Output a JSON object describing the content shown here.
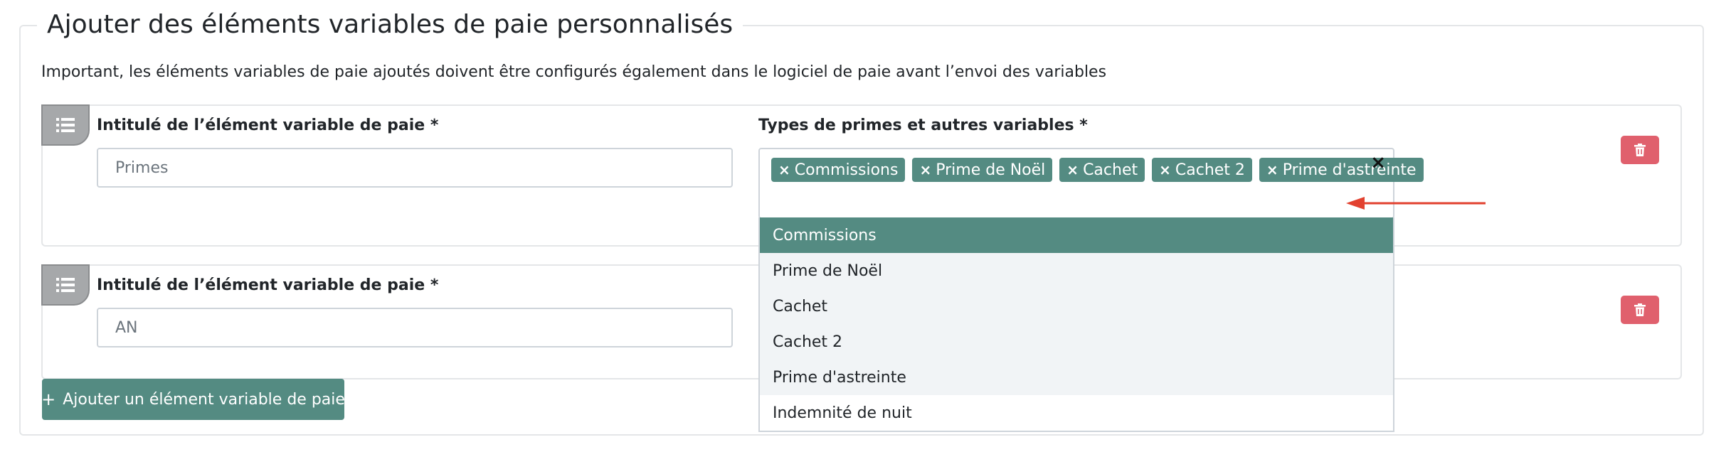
{
  "section": {
    "title": "Ajouter des éléments variables de paie personnalisés",
    "notice": "Important, les éléments variables de paie ajoutés doivent être configurés également dans le logiciel de paie avant l’envoi des variables"
  },
  "items": [
    {
      "label": "Intitulé de l’élément variable de paie *",
      "placeholder": "Primes",
      "types_label": "Types de primes et autres variables *",
      "selected_tags": [
        "Commissions",
        "Prime de Noël",
        "Cachet",
        "Cachet 2",
        "Prime d'astreinte"
      ]
    },
    {
      "label": "Intitulé de l’élément variable de paie *",
      "placeholder": "AN"
    }
  ],
  "tag_remove_symbol": "×",
  "clear_symbol": "×",
  "dropdown_options": [
    "Commissions",
    "Prime de Noël",
    "Cachet",
    "Cachet 2",
    "Prime d'astreinte",
    "Indemnité de nuit"
  ],
  "add_button": {
    "icon": "+",
    "label": "Ajouter un élément variable de paie"
  },
  "colors": {
    "accent": "#548b82",
    "danger": "#e0606d",
    "arrow": "#e2412f",
    "handle": "#a6a8aa"
  }
}
